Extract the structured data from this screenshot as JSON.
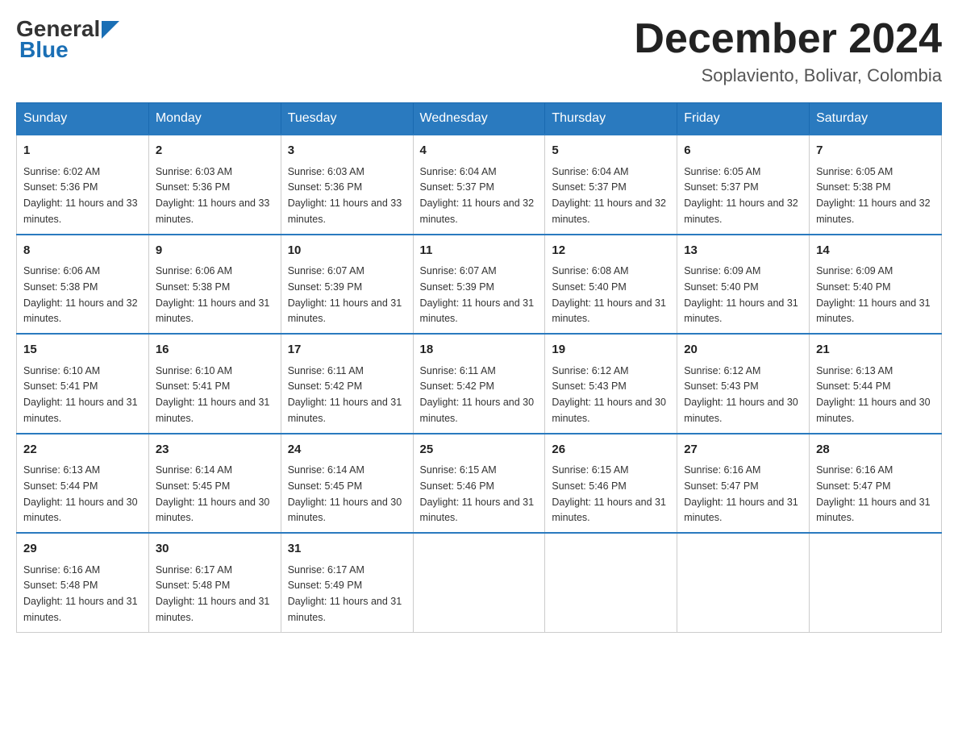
{
  "header": {
    "logo_general": "General",
    "logo_blue": "Blue",
    "month_title": "December 2024",
    "location": "Soplaviento, Bolivar, Colombia"
  },
  "weekdays": [
    "Sunday",
    "Monday",
    "Tuesday",
    "Wednesday",
    "Thursday",
    "Friday",
    "Saturday"
  ],
  "weeks": [
    [
      {
        "day": "1",
        "sunrise": "6:02 AM",
        "sunset": "5:36 PM",
        "daylight": "11 hours and 33 minutes."
      },
      {
        "day": "2",
        "sunrise": "6:03 AM",
        "sunset": "5:36 PM",
        "daylight": "11 hours and 33 minutes."
      },
      {
        "day": "3",
        "sunrise": "6:03 AM",
        "sunset": "5:36 PM",
        "daylight": "11 hours and 33 minutes."
      },
      {
        "day": "4",
        "sunrise": "6:04 AM",
        "sunset": "5:37 PM",
        "daylight": "11 hours and 32 minutes."
      },
      {
        "day": "5",
        "sunrise": "6:04 AM",
        "sunset": "5:37 PM",
        "daylight": "11 hours and 32 minutes."
      },
      {
        "day": "6",
        "sunrise": "6:05 AM",
        "sunset": "5:37 PM",
        "daylight": "11 hours and 32 minutes."
      },
      {
        "day": "7",
        "sunrise": "6:05 AM",
        "sunset": "5:38 PM",
        "daylight": "11 hours and 32 minutes."
      }
    ],
    [
      {
        "day": "8",
        "sunrise": "6:06 AM",
        "sunset": "5:38 PM",
        "daylight": "11 hours and 32 minutes."
      },
      {
        "day": "9",
        "sunrise": "6:06 AM",
        "sunset": "5:38 PM",
        "daylight": "11 hours and 31 minutes."
      },
      {
        "day": "10",
        "sunrise": "6:07 AM",
        "sunset": "5:39 PM",
        "daylight": "11 hours and 31 minutes."
      },
      {
        "day": "11",
        "sunrise": "6:07 AM",
        "sunset": "5:39 PM",
        "daylight": "11 hours and 31 minutes."
      },
      {
        "day": "12",
        "sunrise": "6:08 AM",
        "sunset": "5:40 PM",
        "daylight": "11 hours and 31 minutes."
      },
      {
        "day": "13",
        "sunrise": "6:09 AM",
        "sunset": "5:40 PM",
        "daylight": "11 hours and 31 minutes."
      },
      {
        "day": "14",
        "sunrise": "6:09 AM",
        "sunset": "5:40 PM",
        "daylight": "11 hours and 31 minutes."
      }
    ],
    [
      {
        "day": "15",
        "sunrise": "6:10 AM",
        "sunset": "5:41 PM",
        "daylight": "11 hours and 31 minutes."
      },
      {
        "day": "16",
        "sunrise": "6:10 AM",
        "sunset": "5:41 PM",
        "daylight": "11 hours and 31 minutes."
      },
      {
        "day": "17",
        "sunrise": "6:11 AM",
        "sunset": "5:42 PM",
        "daylight": "11 hours and 31 minutes."
      },
      {
        "day": "18",
        "sunrise": "6:11 AM",
        "sunset": "5:42 PM",
        "daylight": "11 hours and 30 minutes."
      },
      {
        "day": "19",
        "sunrise": "6:12 AM",
        "sunset": "5:43 PM",
        "daylight": "11 hours and 30 minutes."
      },
      {
        "day": "20",
        "sunrise": "6:12 AM",
        "sunset": "5:43 PM",
        "daylight": "11 hours and 30 minutes."
      },
      {
        "day": "21",
        "sunrise": "6:13 AM",
        "sunset": "5:44 PM",
        "daylight": "11 hours and 30 minutes."
      }
    ],
    [
      {
        "day": "22",
        "sunrise": "6:13 AM",
        "sunset": "5:44 PM",
        "daylight": "11 hours and 30 minutes."
      },
      {
        "day": "23",
        "sunrise": "6:14 AM",
        "sunset": "5:45 PM",
        "daylight": "11 hours and 30 minutes."
      },
      {
        "day": "24",
        "sunrise": "6:14 AM",
        "sunset": "5:45 PM",
        "daylight": "11 hours and 30 minutes."
      },
      {
        "day": "25",
        "sunrise": "6:15 AM",
        "sunset": "5:46 PM",
        "daylight": "11 hours and 31 minutes."
      },
      {
        "day": "26",
        "sunrise": "6:15 AM",
        "sunset": "5:46 PM",
        "daylight": "11 hours and 31 minutes."
      },
      {
        "day": "27",
        "sunrise": "6:16 AM",
        "sunset": "5:47 PM",
        "daylight": "11 hours and 31 minutes."
      },
      {
        "day": "28",
        "sunrise": "6:16 AM",
        "sunset": "5:47 PM",
        "daylight": "11 hours and 31 minutes."
      }
    ],
    [
      {
        "day": "29",
        "sunrise": "6:16 AM",
        "sunset": "5:48 PM",
        "daylight": "11 hours and 31 minutes."
      },
      {
        "day": "30",
        "sunrise": "6:17 AM",
        "sunset": "5:48 PM",
        "daylight": "11 hours and 31 minutes."
      },
      {
        "day": "31",
        "sunrise": "6:17 AM",
        "sunset": "5:49 PM",
        "daylight": "11 hours and 31 minutes."
      },
      null,
      null,
      null,
      null
    ]
  ],
  "labels": {
    "sunrise_prefix": "Sunrise: ",
    "sunset_prefix": "Sunset: ",
    "daylight_prefix": "Daylight: "
  }
}
